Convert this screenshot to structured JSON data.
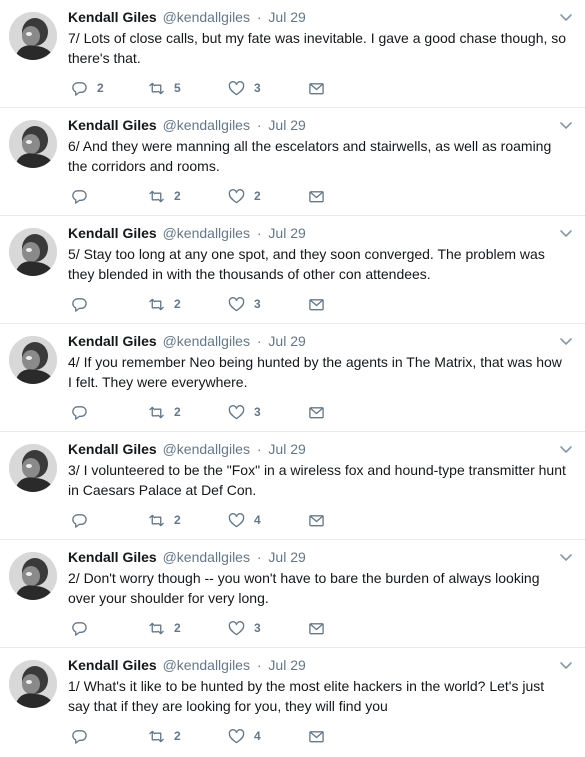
{
  "author": {
    "name": "Kendall Giles",
    "handle": "@kendallgiles",
    "separator": "·"
  },
  "tweets": [
    {
      "date": "Jul 29",
      "text": "7/ Lots of close calls, but my fate was inevitable. I gave a good chase though, so there's that.",
      "replies": "2",
      "retweets": "5",
      "likes": "3"
    },
    {
      "date": "Jul 29",
      "text": "6/ And they were manning all the escelators and stairwells, as well as roaming the corridors and rooms.",
      "replies": "",
      "retweets": "2",
      "likes": "2"
    },
    {
      "date": "Jul 29",
      "text": "5/ Stay too long at any one spot, and they soon converged. The problem was they blended in with the thousands of other con attendees.",
      "replies": "",
      "retweets": "2",
      "likes": "3"
    },
    {
      "date": "Jul 29",
      "text": "4/ If you remember Neo being hunted by the agents in The Matrix, that was how I felt. They were everywhere.",
      "replies": "",
      "retweets": "2",
      "likes": "3"
    },
    {
      "date": "Jul 29",
      "text": "3/ I volunteered to be the \"Fox\" in a wireless fox and hound-type transmitter hunt in Caesars Palace at Def Con.",
      "replies": "",
      "retweets": "2",
      "likes": "4"
    },
    {
      "date": "Jul 29",
      "text": "2/ Don't worry though -- you won't have to bare the burden of always looking over your shoulder for very long.",
      "replies": "",
      "retweets": "2",
      "likes": "3"
    },
    {
      "date": "Jul 29",
      "text": "1/ What's it like to be hunted by the most elite hackers in the world? Let's just say that if they are looking for you, they will find you",
      "replies": "",
      "retweets": "2",
      "likes": "4"
    }
  ],
  "icons": {
    "reply": "reply-icon",
    "retweet": "retweet-icon",
    "like": "heart-icon",
    "dm": "envelope-icon",
    "menu": "chevron-down-icon"
  },
  "colors": {
    "icon": "#657786",
    "divider": "#e6ecf0",
    "text": "#14171a"
  }
}
